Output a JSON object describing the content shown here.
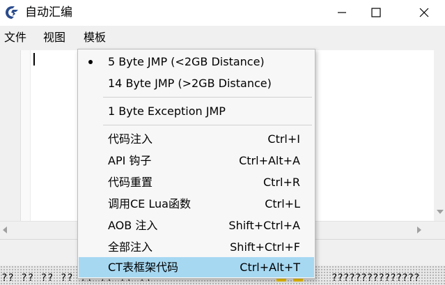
{
  "window": {
    "title": "自动汇编"
  },
  "menubar": {
    "file": "文件",
    "view": "视图",
    "template": "模板"
  },
  "dropdown": {
    "items": [
      {
        "label": "5 Byte JMP (<2GB Distance)",
        "shortcut": "",
        "checked": true
      },
      {
        "label": "14 Byte JMP (>2GB Distance)",
        "shortcut": ""
      },
      {
        "label": "1 Byte Exception JMP",
        "shortcut": ""
      },
      {
        "label": "代码注入",
        "shortcut": "Ctrl+I"
      },
      {
        "label": "API 钩子",
        "shortcut": "Ctrl+Alt+A"
      },
      {
        "label": "代码重置",
        "shortcut": "Ctrl+R"
      },
      {
        "label": "调用CE Lua函数",
        "shortcut": "Ctrl+L"
      },
      {
        "label": "AOB 注入",
        "shortcut": "Shift+Ctrl+A"
      },
      {
        "label": "全部注入",
        "shortcut": "Shift+Ctrl+F"
      },
      {
        "label": "CT表框架代码",
        "shortcut": "Ctrl+Alt+T",
        "highlighted": true
      }
    ]
  },
  "hexview": {
    "left_text": "?? ?? ?? ?? ?? ?? ?? ??",
    "right_text": "???????????????"
  },
  "colors": {
    "highlight": "#a6d8f2",
    "menubar": "#f0f0f0",
    "marker": "#f3c400"
  }
}
